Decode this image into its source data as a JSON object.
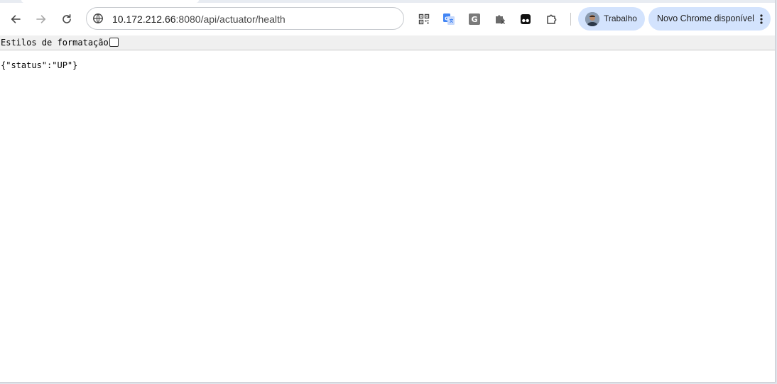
{
  "toolbar": {
    "back_icon": "arrow-left-icon",
    "forward_icon": "arrow-right-icon",
    "reload_icon": "reload-icon",
    "omnibox": {
      "host": "10.172.212.66",
      "path": ":8080/api/actuator/health",
      "site_info_icon": "tune-icon"
    },
    "extensions": [
      {
        "name": "qr-code-icon"
      },
      {
        "name": "google-translate-icon"
      },
      {
        "name": "grammar-g-icon",
        "glyph": "G"
      },
      {
        "name": "extension-puzzle-shield-icon"
      },
      {
        "name": "tampermonkey-icon"
      },
      {
        "name": "extensions-puzzle-icon"
      }
    ],
    "profile": {
      "label": "Trabalho"
    },
    "update": {
      "label": "Novo Chrome disponível"
    }
  },
  "pretty_print": {
    "label": "Estilos de formatação",
    "checked": false
  },
  "body": {
    "json": "{\"status\":\"UP\"}"
  },
  "colors": {
    "chip_bg": "#d3e3fd",
    "toolbar_bg": "#ffffff",
    "pretty_bar_bg": "#f0f0f0"
  }
}
